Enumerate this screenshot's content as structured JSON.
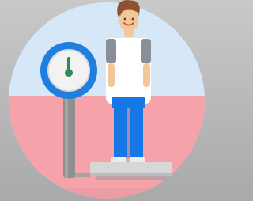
{
  "illustration": {
    "icon": "person-on-weighing-scale-icon",
    "colors": {
      "page_background": "#b8b8b8",
      "circle_top": "#d6e8f7",
      "circle_bottom": "#f5a2aa",
      "gauge_ring": "#1e7fe0",
      "gauge_face": "#f2f2f2",
      "gauge_needle": "#2f8a57",
      "pole": "#8f8f8f",
      "platform": "#d7d7d7",
      "skin": "#f2c79a",
      "hair": "#8b4d2a",
      "shirt": "#ffffff",
      "sleeves": "#8a8f97",
      "pants": "#1677e6",
      "shoes": "#ececec"
    }
  }
}
